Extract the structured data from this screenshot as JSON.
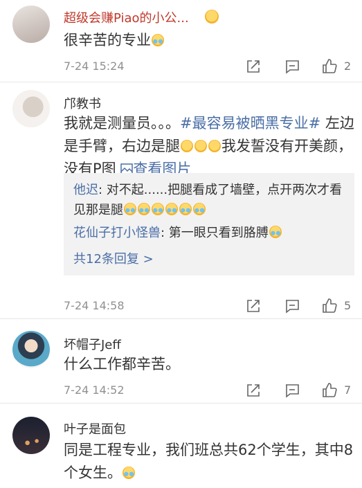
{
  "comments": [
    {
      "username": "超级会赚Piao的小公...",
      "text": "很辛苦的专业",
      "time": "7-24 15:24",
      "likes": "2"
    },
    {
      "username": "邝教书",
      "text_a": "我就是测量员。。。",
      "hashtag": "#最容易被晒黑专业#",
      "text_b": " 左边是手臂，右边是腿",
      "text_c": "我发誓没有开美颜，没有P图",
      "view_image": "查看图片",
      "replies": [
        {
          "name": "他迟",
          "text": ": 对不起......把腿看成了墙壁，点开两次才看见那是腿"
        },
        {
          "name": "花仙子打小怪兽",
          "text": ": 第一眼只看到胳膊"
        }
      ],
      "more_replies": "共12条回复 >",
      "time": "7-24 14:58",
      "likes": "5"
    },
    {
      "username": "坏帽子Jeff",
      "text": "什么工作都辛苦。",
      "time": "7-24 14:52",
      "likes": "7"
    },
    {
      "username": "叶子是面包",
      "text": "同是工程专业，我们班总共62个学生，其中8个女生。"
    }
  ],
  "colors": {
    "username": "#c0392b",
    "link": "#4a6ea6",
    "meta": "#909090",
    "reply_bg": "#f2f2f2"
  },
  "icons": [
    "share-icon",
    "comment-icon",
    "like-icon",
    "heart-eyes-emoji",
    "tears-of-joy-emoji",
    "slight-smile-emoji",
    "image-icon"
  ]
}
